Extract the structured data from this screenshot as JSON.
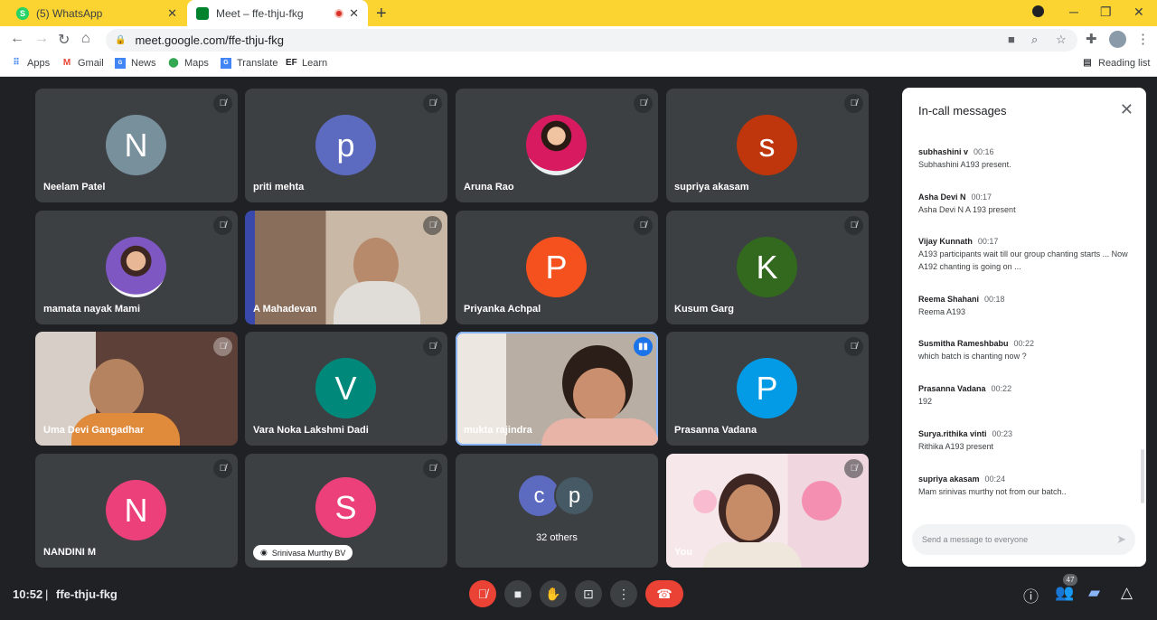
{
  "browser": {
    "tabs": [
      {
        "title": "(5) WhatsApp"
      },
      {
        "title": "Meet – ffe-thju-fkg"
      }
    ],
    "url": "meet.google.com/ffe-thju-fkg",
    "bookmarks": [
      {
        "label": "Apps"
      },
      {
        "label": "Gmail"
      },
      {
        "label": "News"
      },
      {
        "label": "Maps"
      },
      {
        "label": "Translate"
      },
      {
        "label": "Learn"
      }
    ],
    "reading_list": "Reading list"
  },
  "participants": [
    {
      "name": "Neelam Patel",
      "initial": "N",
      "color": "#78909c"
    },
    {
      "name": "priti mehta",
      "initial": "p",
      "color": "#5c6bc0"
    },
    {
      "name": "Aruna Rao",
      "initial": "",
      "color": "#c2185b"
    },
    {
      "name": "supriya akasam",
      "initial": "s",
      "color": "#bf360c"
    },
    {
      "name": "mamata nayak Mami",
      "initial": "",
      "color": "#7e57c2"
    },
    {
      "name": "A Mahadevan",
      "initial": "",
      "color": "#6d5c4e"
    },
    {
      "name": "Priyanka Achpal",
      "initial": "P",
      "color": "#f4511e"
    },
    {
      "name": "Kusum Garg",
      "initial": "K",
      "color": "#33691e"
    },
    {
      "name": "Uma Devi Gangadhar",
      "initial": "",
      "color": "#8d6e63"
    },
    {
      "name": "Vara Noka Lakshmi Dadi",
      "initial": "V",
      "color": "#00897b"
    },
    {
      "name": "mukta rajindra",
      "initial": "",
      "color": "#795548"
    },
    {
      "name": "Prasanna Vadana",
      "initial": "P",
      "color": "#039be5"
    },
    {
      "name": "NANDINI M",
      "initial": "N",
      "color": "#ec407a"
    },
    {
      "name": "Srinivasa Murthy BV",
      "initial": "S",
      "color": "#ec407a"
    },
    {
      "name": "32 others",
      "initial": "",
      "color": "#3c4043"
    },
    {
      "name": "You",
      "initial": "",
      "color": "#a1887f"
    }
  ],
  "others_avatars": [
    {
      "initial": "c",
      "color": "#5c6bc0"
    },
    {
      "initial": "p",
      "color": "#455a64"
    }
  ],
  "chat": {
    "title": "In-call messages",
    "messages": [
      {
        "sender": "subhashini v",
        "time": "00:16",
        "text": "Subhashini A193 present."
      },
      {
        "sender": "Asha Devi N",
        "time": "00:17",
        "text": "Asha Devi N  A 193 present"
      },
      {
        "sender": "Vijay Kunnath",
        "time": "00:17",
        "text": "A193 participants wait till our group chanting starts ... Now A192 chanting is going on ..."
      },
      {
        "sender": "Reema Shahani",
        "time": "00:18",
        "text": "Reema A193"
      },
      {
        "sender": "Susmitha Rameshbabu",
        "time": "00:22",
        "text": "which batch is chanting now ?"
      },
      {
        "sender": "Prasanna Vadana",
        "time": "00:22",
        "text": "192"
      },
      {
        "sender": "Surya.rithika vinti",
        "time": "00:23",
        "text": "Rithika A193 present"
      },
      {
        "sender": "supriya akasam",
        "time": "00:24",
        "text": "Mam srinivas murthy not from our batch.."
      }
    ],
    "input_placeholder": "Send a message to everyone"
  },
  "meeting": {
    "time": "10:52",
    "separator": "|",
    "code": "ffe-thju-fkg",
    "participant_count": "47"
  }
}
